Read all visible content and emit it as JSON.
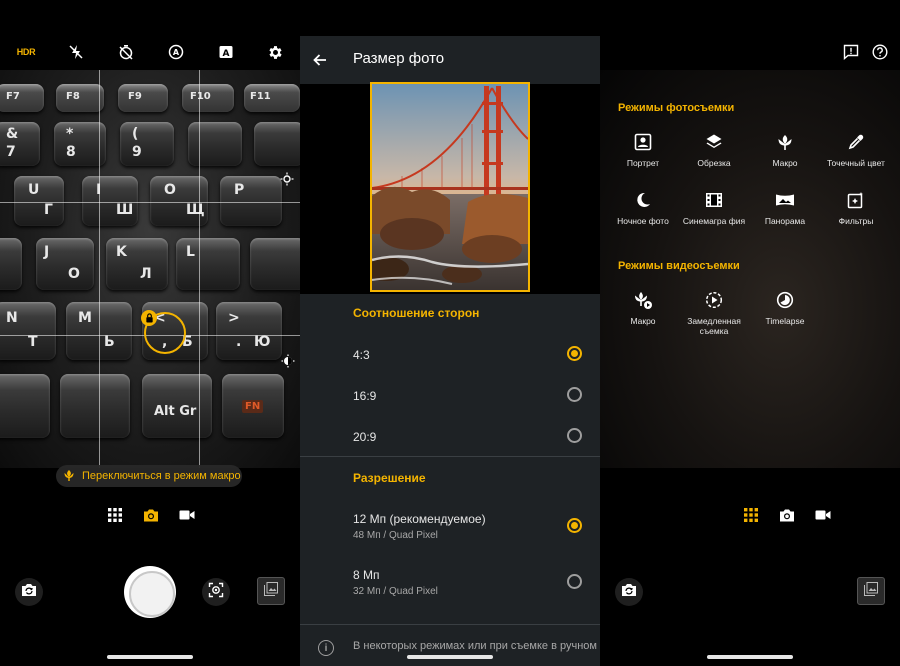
{
  "camera": {
    "hdr_label": "HDR",
    "macro_hint": "Переключиться в режим макро",
    "keys": {
      "f7": "F7",
      "f8": "F8",
      "f9": "F9",
      "f10": "F10",
      "f11": "F11",
      "amp": "&",
      "seven": "7",
      "star": "*",
      "eight": "8",
      "paren": "(",
      "nine": "9",
      "u_lat": "U",
      "g_cyr": "Г",
      "i_lat": "I",
      "sh_cyr": "Ш",
      "o_lat": "O",
      "shch_cyr": "Щ",
      "p_lat": "P",
      "j_lat": "J",
      "o_cyr": "О",
      "k_lat": "K",
      "l_cyr": "Л",
      "l_lat": "L",
      "n_lat": "N",
      "t_cyr": "Т",
      "m_lat": "M",
      "soft_cyr": "Ь",
      "lt": "<",
      "comma": ",",
      "b_cyr": "Б",
      "gt": ">",
      "dot": ".",
      "yu_cyr": "Ю",
      "altgr": "Alt Gr",
      "fn": "FN"
    }
  },
  "settings": {
    "title": "Размер фото",
    "aspect_section": "Соотношение сторон",
    "aspect_options": [
      "4:3",
      "16:9",
      "20:9"
    ],
    "aspect_selected": "4:3",
    "resolution_section": "Разрешение",
    "resolution_options": [
      {
        "label": "12 Мп (рекомендуемое)",
        "sub": "48 Мп / Quad Pixel"
      },
      {
        "label": "8 Мп",
        "sub": "32 Мп / Quad Pixel"
      }
    ],
    "resolution_selected": "12 Мп (рекомендуемое)",
    "info_text": "В некоторых режимах или при съемке в ручном"
  },
  "modes": {
    "photo_section": "Режимы фотосъемки",
    "photo_modes": [
      {
        "label": "Портрет",
        "icon": "portrait-icon"
      },
      {
        "label": "Обрезка",
        "icon": "layers-icon"
      },
      {
        "label": "Макро",
        "icon": "tulip-icon"
      },
      {
        "label": "Точечный цвет",
        "icon": "eyedropper-icon"
      },
      {
        "label": "Ночное фото",
        "icon": "moon-icon"
      },
      {
        "label": "Синемагра фия",
        "icon": "film-icon"
      },
      {
        "label": "Панорама",
        "icon": "panorama-icon"
      },
      {
        "label": "Фильтры",
        "icon": "filter-icon"
      }
    ],
    "video_section": "Режимы видеосъемки",
    "video_modes": [
      {
        "label": "Макро",
        "icon": "tulip-video-icon"
      },
      {
        "label": "Замедленная съемка",
        "icon": "slowmo-icon"
      },
      {
        "label": "Timelapse",
        "icon": "timelapse-icon"
      }
    ]
  },
  "colors": {
    "accent": "#f4b400",
    "panel_bg": "#1e2225",
    "text_secondary": "#a8a8a8"
  }
}
